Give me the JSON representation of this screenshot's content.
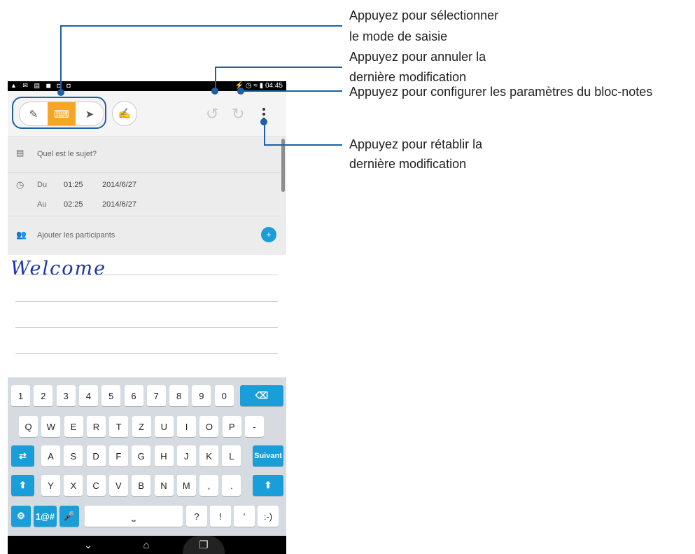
{
  "statusbar": {
    "left_icons": "▲ ✉ ▤ ◼ ◘ ◘",
    "right_icons": "⚡ ◷ ≈ ▮",
    "time": "04:45"
  },
  "toolbar": {
    "modes": [
      {
        "name": "handwriting-mode",
        "icon": "✎"
      },
      {
        "name": "keyboard-mode",
        "icon": "⌨"
      },
      {
        "name": "pen-mode",
        "icon": "➤"
      }
    ],
    "active_mode": "keyboard-mode",
    "signature_icon": "✍",
    "undo_icon": "↺",
    "redo_icon": "↻"
  },
  "form": {
    "subject_placeholder": "Quel est le sujet?",
    "from_label": "Du",
    "from_time": "01:25",
    "from_date": "2014/6/27",
    "to_label": "Au",
    "to_time": "02:25",
    "to_date": "2014/6/27",
    "participants_placeholder": "Ajouter les participants"
  },
  "note": {
    "text": "Welcome"
  },
  "keyboard": {
    "row1": [
      "1",
      "2",
      "3",
      "4",
      "5",
      "6",
      "7",
      "8",
      "9",
      "0"
    ],
    "backspace": "⌫",
    "row2": [
      "Q",
      "W",
      "E",
      "R",
      "T",
      "Z",
      "U",
      "I",
      "O",
      "P",
      "-"
    ],
    "row3": [
      "A",
      "S",
      "D",
      "F",
      "G",
      "H",
      "J",
      "K",
      "L"
    ],
    "row3_tab": "⇄",
    "suivant": "Suivant",
    "row4": [
      "Y",
      "X",
      "C",
      "V",
      "B",
      "N",
      "M",
      ",",
      "."
    ],
    "shift": "⬆",
    "settings": "⚙",
    "symbols": "1@#",
    "mic": "🎤",
    "space": "⎵",
    "row5_extra": [
      "?",
      "!",
      "'",
      ":-)"
    ]
  },
  "navbar": {
    "back": "⌄",
    "home": "⌂",
    "recents": "❐"
  },
  "annotations": {
    "mode_select": [
      "Appuyez pour sélectionner",
      "le mode de saisie"
    ],
    "undo": [
      "Appuyez pour annuler la",
      "dernière modification"
    ],
    "settings": "Appuyez pour configurer les paramètres du bloc-notes",
    "redo": [
      "Appuyez pour rétablir la",
      "dernière modification"
    ]
  },
  "colors": {
    "callout": "#1f5fa6",
    "active_mode": "#f5a623",
    "keyboard_accent": "#1a9ed9",
    "handwriting": "#1c34a8"
  }
}
